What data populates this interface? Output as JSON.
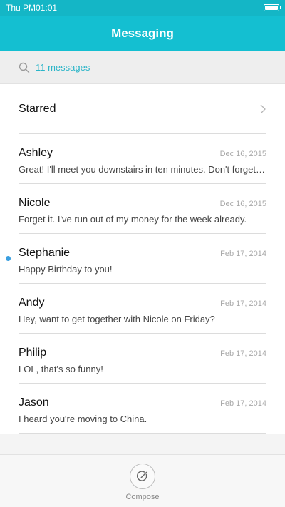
{
  "status_bar": {
    "time": "Thu PM01:01",
    "battery_level": 1.0
  },
  "header": {
    "title": "Messaging"
  },
  "search": {
    "text": "11 messages",
    "icon": "search-icon"
  },
  "starred": {
    "label": "Starred",
    "icon": "chevron-right-icon"
  },
  "messages": [
    {
      "name": "Ashley",
      "date": "Dec 16, 2015",
      "preview": "Great! I'll meet you downstairs in ten minutes. Don't forget your umbrella.",
      "unread": false
    },
    {
      "name": "Nicole",
      "date": "Dec 16, 2015",
      "preview": "Forget it. I've run out of my money for the week already.",
      "unread": false
    },
    {
      "name": "Stephanie",
      "date": "Feb 17, 2014",
      "preview": "Happy Birthday to you!",
      "unread": true
    },
    {
      "name": "Andy",
      "date": "Feb 17, 2014",
      "preview": "Hey, want to get together with Nicole on Friday?",
      "unread": false
    },
    {
      "name": "Philip",
      "date": "Feb 17, 2014",
      "preview": "LOL, that's so funny!",
      "unread": false
    },
    {
      "name": "Jason",
      "date": "Feb 17, 2014",
      "preview": "I heard you're moving to China.",
      "unread": false
    }
  ],
  "compose": {
    "label": "Compose",
    "icon": "compose-icon"
  },
  "colors": {
    "accent": "#14bfd1",
    "status_bar": "#14b6c6",
    "unread_dot": "#3a9fe0",
    "search_text": "#2bb5c8"
  }
}
